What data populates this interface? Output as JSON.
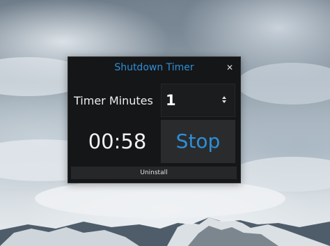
{
  "window": {
    "title": "Shutdown Timer",
    "close_glyph": "✕"
  },
  "timer": {
    "label": "Timer Minutes",
    "minutes_value": "1",
    "countdown": "00:58"
  },
  "buttons": {
    "stop_label": "Stop",
    "uninstall_label": "Uninstall"
  },
  "icons": {
    "close": "close-icon",
    "spin": "up-down-arrows-icon"
  },
  "colors": {
    "accent": "#2e8fd8",
    "window_bg": "#151617",
    "button_bg": "#2a2b2d"
  }
}
